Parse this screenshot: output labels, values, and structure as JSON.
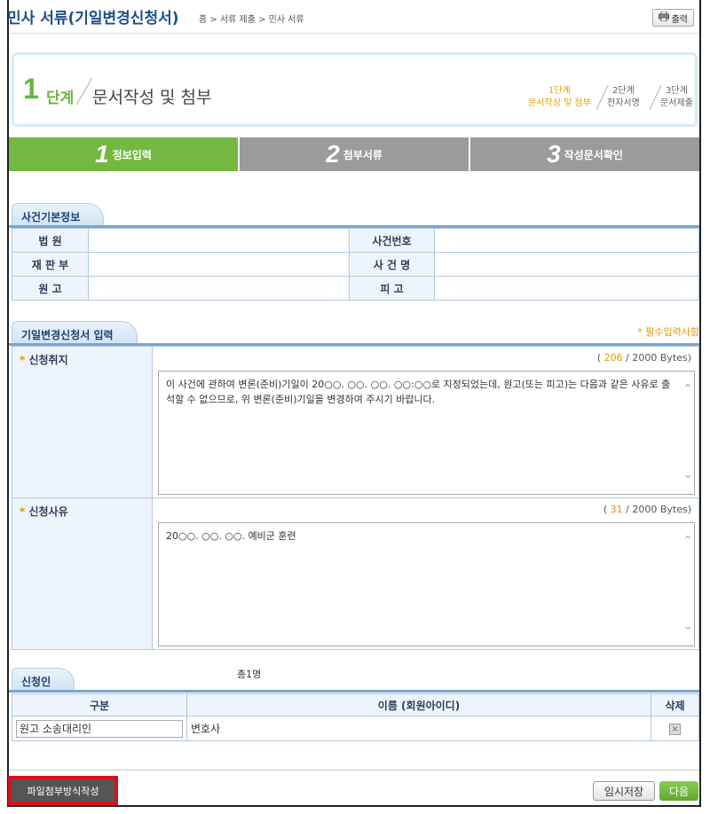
{
  "header": {
    "title": "민사 서류(기일변경신청서)",
    "breadcrumb": "홈 > 서류 제출 > 민사 서류",
    "print_label": "출력"
  },
  "step": {
    "number": "1",
    "word": "단계",
    "title": "문서작성 및 첨부",
    "mini_steps": [
      {
        "line1": "1단계",
        "line2": "문서작성 및 첨부"
      },
      {
        "line1": "2단계",
        "line2": "전자서명"
      },
      {
        "line1": "3단계",
        "line2": "문서제출"
      }
    ]
  },
  "tabs": [
    {
      "num": "1",
      "label": "정보입력"
    },
    {
      "num": "2",
      "label": "첨부서류"
    },
    {
      "num": "3",
      "label": "작성문서확인"
    }
  ],
  "case_info": {
    "section_title": "사건기본정보",
    "court_label": "법 원",
    "court_value": "",
    "case_no_label": "사건번호",
    "case_no_value": "",
    "division_label": "재 판 부",
    "division_value": "",
    "case_name_label": "사 건 명",
    "case_name_value": "",
    "plaintiff_label": "원 고",
    "plaintiff_value": "",
    "defendant_label": "피 고",
    "defendant_value": ""
  },
  "application": {
    "section_title": "기일변경신청서 입력",
    "required_note": "* 필수입력사항",
    "purpose_label": "신청취지",
    "purpose_count": "206",
    "purpose_limit": "/ 2000 Bytes)",
    "purpose_text": "이 사건에 관하여 변론(준비)기일이 20○○. ○○. ○○. ○○:○○로 지정되었는데, 원고(또는 피고)는 다음과 같은 사유로 출석할 수 없으므로, 위 변론(준비)기일을 변경하여 주시기 바랍니다.",
    "reason_label": "신청사유",
    "reason_count": "31",
    "reason_limit": "/ 2000 Bytes)",
    "reason_text": "20○○. ○○. ○○. 예비군 훈련"
  },
  "applicant": {
    "section_title": "신청인",
    "total": "총1명",
    "col_type": "구분",
    "col_name": "이름 (회원아이디)",
    "col_delete": "삭제",
    "rows": [
      {
        "type": "원고 소송대리인",
        "name": "변호사"
      }
    ]
  },
  "buttons": {
    "file_attach": "파일첨부방식작성",
    "temp_save": "임시저장",
    "next": "다음"
  },
  "colors": {
    "accent_green": "#74b841",
    "title_blue": "#1f4e8c",
    "highlight_red": "#d9101a",
    "required_orange": "#e69500"
  }
}
